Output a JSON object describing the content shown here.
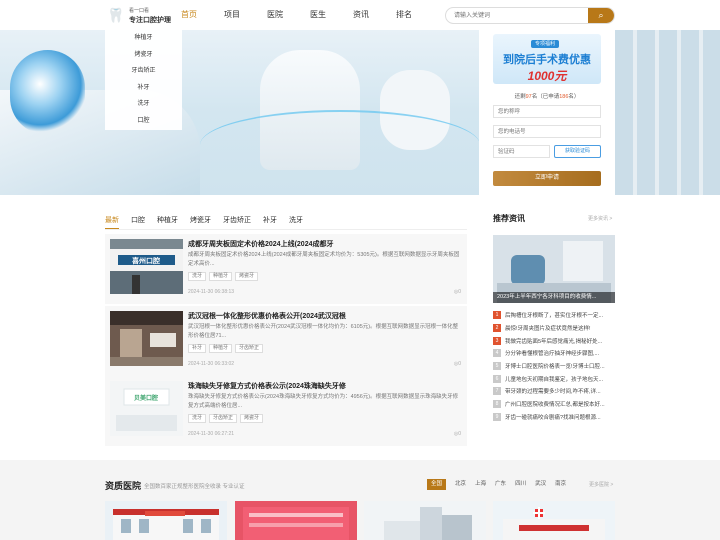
{
  "header": {
    "logo_line1": "看一口看",
    "logo_line2": "专注口腔护理",
    "nav": [
      "首页",
      "项目",
      "医院",
      "医生",
      "资讯",
      "排名"
    ],
    "search_placeholder": "请输入关键词"
  },
  "categories": [
    "种植牙",
    "烤瓷牙",
    "牙齿矫正",
    "补牙",
    "洗牙",
    "口腔"
  ],
  "form": {
    "promo_tag": "专项福利",
    "promo_title": "到院后手术费优惠",
    "promo_amount": "1000元",
    "count_prefix": "还剩",
    "count_left": "97",
    "count_mid": "名（已申请",
    "count_applied": "186",
    "count_suffix": "名）",
    "name_placeholder": "您的称呼",
    "phone_placeholder": "您的电话号",
    "code_placeholder": "验证码",
    "code_button": "获取验证码",
    "submit": "立即申请"
  },
  "tabs": [
    "最新",
    "口腔",
    "种植牙",
    "烤瓷牙",
    "牙齿矫正",
    "补牙",
    "洗牙"
  ],
  "articles": [
    {
      "title": "成都牙周夹板固定术价格2024上线(2024成都牙",
      "desc": "成都牙周夹板固定术价格2024上线(2024成都牙周夹板固定术均价为：5305元)。根据互联网数据显示牙周夹板固定术高价...",
      "tags": [
        "洗牙",
        "种植牙",
        "烤瓷牙"
      ],
      "time": "2024-11-30 06:38:13",
      "views": "0",
      "thumb_text": "喜州口腔"
    },
    {
      "title": "武汉冠根一体化整形优惠价格表公开(2024武汉冠根",
      "desc": "武汉冠根一体化整形优惠价格表公开(2024武汉冠根一体化均价为：6105元)。根据互联网数据显示冠根一体化整形价格位居71...",
      "tags": [
        "补牙",
        "种植牙",
        "牙齿矫正"
      ],
      "time": "2024-11-30 06:33:02",
      "views": "0",
      "thumb_text": ""
    },
    {
      "title": "珠海缺失牙修复方式价格表公示(2024珠海缺失牙修",
      "desc": "珠海缺失牙修复方式价格表公示(2024珠海缺失牙修复方式均价为：4956元)。根据互联网数据显示珠海缺失牙修复方式高端价格位居...",
      "tags": [
        "洗牙",
        "牙齿矫正",
        "烤瓷牙"
      ],
      "time": "2024-11-30 06:27:21",
      "views": "0",
      "thumb_text": "贝美口腔"
    }
  ],
  "recommend": {
    "title": "推荐资讯",
    "more": "更多资讯 >",
    "image_caption": "2023年上半年西宁各牙科项目的收费情...",
    "items": [
      "后掏槽位牙根断了，甚实位牙根不一定...",
      "晨惊!牙周夹图片及症状竟然是这样!",
      "我做完齿贴面5年后感觉痛光,揭秘好处...",
      "分分钟看懂根管治疗抽牙神经步骤图,...",
      "牙博士口腔医院价格表一览!牙博士口腔...",
      "儿童地包天初期自我鉴定，孩子地包天...",
      "带牙颈的过程需要多少时间,咋不疼,详...",
      "广州口腔医院收费情况汇总,都是按本好...",
      "牙齿一碰就痛咬合剧痛?找准问题根源..."
    ]
  },
  "hospitals": {
    "title": "资质医院",
    "subtitle": "全国数百家正规整形医院全收录 专业认证",
    "cities": [
      "全国",
      "北京",
      "上海",
      "广东",
      "四川",
      "武汉",
      "南京"
    ],
    "more": "更多医院 >"
  }
}
